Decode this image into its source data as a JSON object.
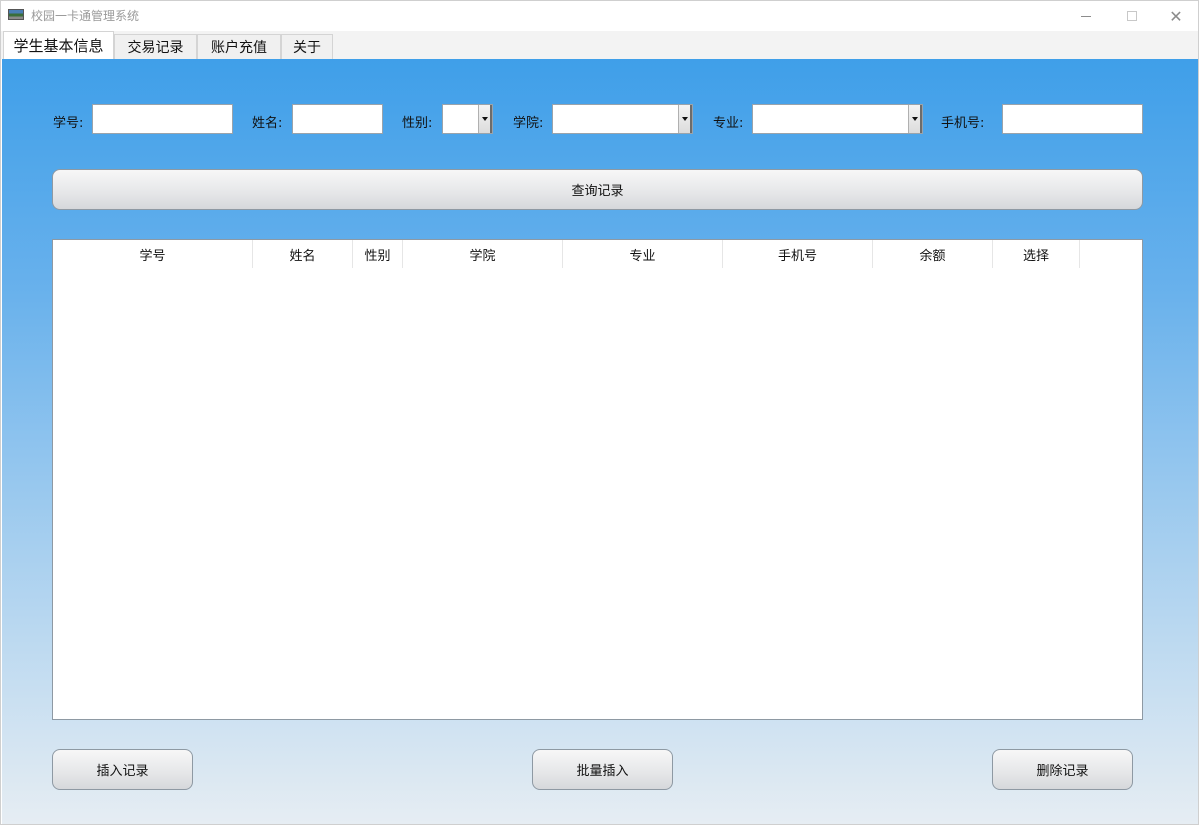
{
  "window": {
    "title": "校园一卡通管理系统",
    "minimize_icon": "minimize-icon",
    "maximize_icon": "maximize-icon",
    "close_symbol": "✕"
  },
  "tabs": [
    {
      "label": "学生基本信息",
      "active": true
    },
    {
      "label": "交易记录",
      "active": false
    },
    {
      "label": "账户充值",
      "active": false
    },
    {
      "label": "关于",
      "active": false
    }
  ],
  "filters": {
    "student_id_label": "学号:",
    "student_id_value": "",
    "name_label": "姓名:",
    "name_value": "",
    "gender_label": "性别:",
    "gender_value": "",
    "college_label": "学院:",
    "college_value": "",
    "major_label": "专业:",
    "major_value": "",
    "phone_label": "手机号:",
    "phone_value": ""
  },
  "query_button": "查询记录",
  "table": {
    "columns": [
      "学号",
      "姓名",
      "性别",
      "学院",
      "专业",
      "手机号",
      "余额",
      "选择"
    ],
    "rows": []
  },
  "actions": {
    "insert": "插入记录",
    "batch_insert": "批量插入",
    "delete": "删除记录"
  },
  "colors": {
    "gradient_top": "#3f9fe9",
    "gradient_bottom": "#e6edf3"
  }
}
